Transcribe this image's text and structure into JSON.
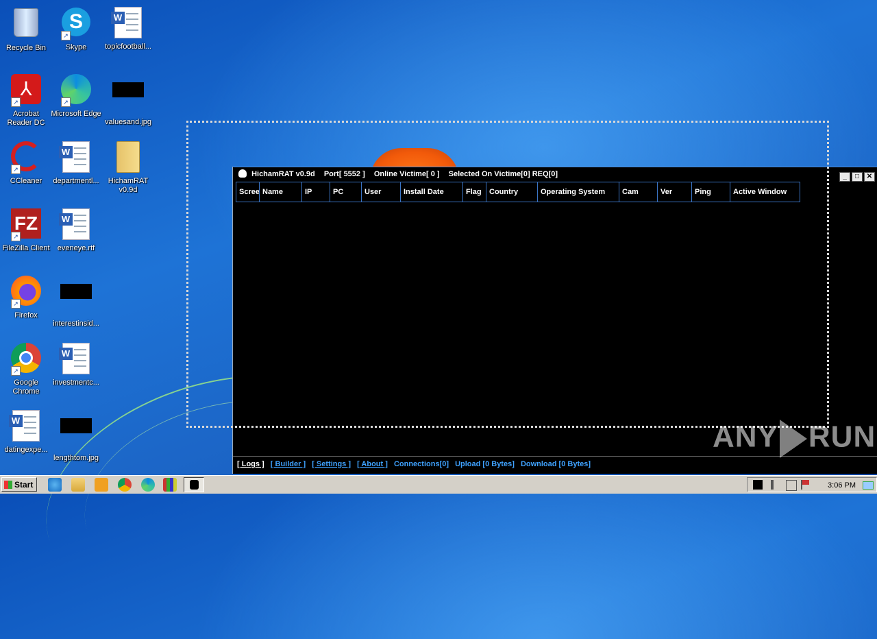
{
  "desktop": {
    "icons": [
      {
        "label": "Recycle Bin"
      },
      {
        "label": "Skype"
      },
      {
        "label": "topicfootball..."
      },
      {
        "label": "Acrobat Reader DC"
      },
      {
        "label": "Microsoft Edge"
      },
      {
        "label": "valuesand.jpg"
      },
      {
        "label": "CCleaner"
      },
      {
        "label": "departmentl..."
      },
      {
        "label": "HichamRAT v0.9d"
      },
      {
        "label": "FileZilla Client"
      },
      {
        "label": "eveneye.rtf"
      },
      {
        "label": "Firefox"
      },
      {
        "label": "interestinsid..."
      },
      {
        "label": "Google Chrome"
      },
      {
        "label": "investmentc..."
      },
      {
        "label": "datingexpe..."
      },
      {
        "label": "lengthtom.jpg"
      }
    ]
  },
  "window": {
    "title_app": "HichamRAT v0.9d",
    "title_port": "Port[ 5552 ]",
    "title_online": "Online Victime[ 0 ]",
    "title_selected": "Selected On Victime[0] REQ[0]",
    "columns": [
      "Screen",
      "Name",
      "IP",
      "PC",
      "User",
      "Install Date",
      "Flag",
      "Country",
      "Operating System",
      "Cam",
      "Ver",
      "Ping",
      "Active Window"
    ],
    "footer": {
      "logs": "[ Logs ]",
      "builder": "[ Builder ]",
      "settings": "[ Settings ]",
      "about": "[ About ]",
      "connections": "Connections[0]",
      "upload": "Upload [0 Bytes]",
      "download": "Download [0 Bytes]"
    }
  },
  "watermark": {
    "left": "ANY",
    "right": "RUN"
  },
  "taskbar": {
    "start_label": "Start",
    "clock": "3:06 PM"
  }
}
